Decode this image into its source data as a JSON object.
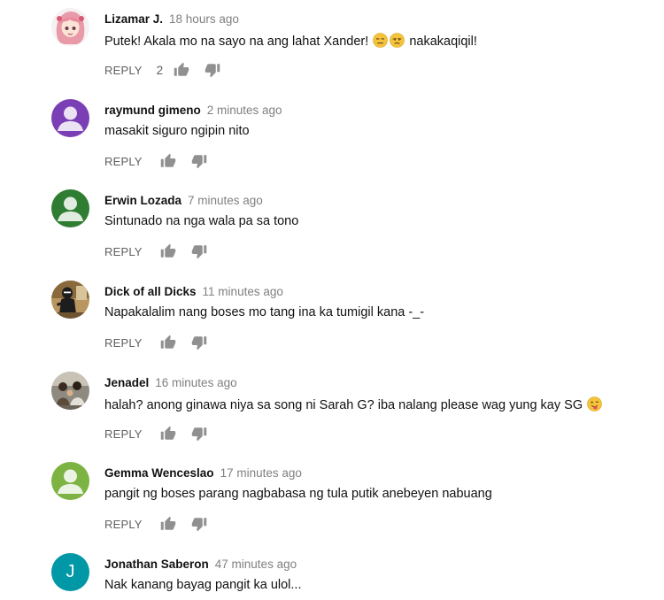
{
  "reply_label": "REPLY",
  "colors": {
    "purple": "#7b3fb5",
    "dark_green": "#2e7d32",
    "light_green": "#7cb342",
    "teal": "#0097a7",
    "meta_gray": "#808080"
  },
  "comments": [
    {
      "author": "Lizamar J.",
      "time": "18 hours ago",
      "text_before": "Putek! Akala mo na sayo na ang lahat Xander! ",
      "text_after": " nakakaqiqil!",
      "emojis": [
        "expressionless-face-emoji",
        "unamused-face-emoji"
      ],
      "likes": "2",
      "avatar": "anime-girl-photo"
    },
    {
      "author": "raymund gimeno",
      "time": "2 minutes ago",
      "text": "masakit siguro ngipin nito",
      "avatar": "default-person-purple"
    },
    {
      "author": "Erwin Lozada",
      "time": "7 minutes ago",
      "text": "Sintunado na nga wala pa sa tono",
      "avatar": "default-person-dark-green"
    },
    {
      "author": "Dick of all Dicks",
      "time": "11 minutes ago",
      "text": "Napakalalim nang boses mo tang ina ka tumigil kana -_-",
      "avatar": "figure-photo"
    },
    {
      "author": "Jenadel",
      "time": "16 minutes ago",
      "text": "halah? anong ginawa niya sa song ni Sarah G? iba nalang please wag yung kay SG ",
      "emojis": [
        "tongue-wink-face-emoji"
      ],
      "avatar": "group-photo"
    },
    {
      "author": "Gemma Wenceslao",
      "time": "17 minutes ago",
      "text": "pangit ng boses parang nagbabasa ng tula putik anebeyen nabuang",
      "avatar": "default-person-light-green"
    },
    {
      "author": "Jonathan Saberon",
      "time": "47 minutes ago",
      "text": "Nak kanang bayag pangit ka ulol...",
      "avatar_letter": "J",
      "avatar": "letter-avatar-teal"
    }
  ]
}
